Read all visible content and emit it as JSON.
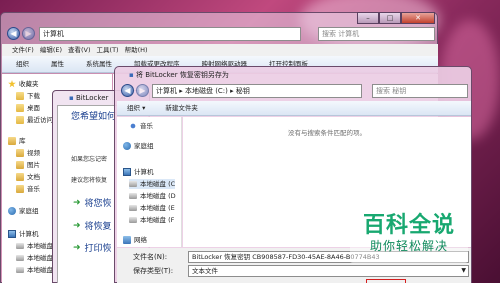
{
  "explorer": {
    "address": "计算机",
    "search_placeholder": "搜索 计算机",
    "menu": [
      "文件(F)",
      "编辑(E)",
      "查看(V)",
      "工具(T)",
      "帮助(H)"
    ],
    "toolbar": [
      "组织",
      "属性",
      "系统属性",
      "卸载或更改程序",
      "映射网络驱动器",
      "打开控制面板"
    ],
    "nav": [
      {
        "label": "收藏夹",
        "icon": "star-icon"
      },
      {
        "label": "下载",
        "icon": "folder-icon"
      },
      {
        "label": "桌面",
        "icon": "folder-icon"
      },
      {
        "label": "最近访问",
        "icon": "folder-icon"
      },
      {
        "label": "库",
        "icon": "library-icon"
      },
      {
        "label": "视频",
        "icon": "library-icon"
      },
      {
        "label": "图片",
        "icon": "library-icon"
      },
      {
        "label": "文档",
        "icon": "library-icon"
      },
      {
        "label": "音乐",
        "icon": "library-icon"
      },
      {
        "label": "家庭组",
        "icon": "homegroup-icon"
      },
      {
        "label": "计算机",
        "icon": "computer-icon"
      },
      {
        "label": "本地磁盘",
        "icon": "disk-icon"
      },
      {
        "label": "本地磁盘",
        "icon": "disk-icon"
      },
      {
        "label": "本地磁盘",
        "icon": "disk-icon"
      }
    ],
    "content_heading": "硬"
  },
  "bitlocker": {
    "title": "BitLocker",
    "question": "您希望如何",
    "para1": "如果您忘记密",
    "para2": "建议您将恢复",
    "option1": "将您恢",
    "option2": "将恢复",
    "option3": "打印恢"
  },
  "saveas": {
    "title": "将 BitLocker 恢复密钥另存为",
    "address": "计算机 ▸ 本地磁盘 (C:) ▸ 秘钥",
    "search_placeholder": "搜索 秘钥",
    "toolbar": [
      "组织 ▾",
      "新建文件夹"
    ],
    "empty_message": "没有与搜索条件匹配的项。",
    "nav": [
      {
        "label": "音乐",
        "icon": "music-icon"
      },
      {
        "label": "家庭组",
        "icon": "homegroup-icon"
      },
      {
        "label": "计算机",
        "icon": "computer-icon"
      },
      {
        "label": "本地磁盘 (C",
        "icon": "disk-icon"
      },
      {
        "label": "本地磁盘 (D",
        "icon": "disk-icon"
      },
      {
        "label": "本地磁盘 (E",
        "icon": "disk-icon"
      },
      {
        "label": "本地磁盘 (F",
        "icon": "disk-icon"
      },
      {
        "label": "网络",
        "icon": "network-icon"
      }
    ],
    "filename_label": "文件名(N):",
    "filename_value": "BitLocker 恢复密钥 CB908587-FD30-45AE-8A46-B0774B43",
    "filetype_label": "保存类型(T):",
    "filetype_value": "文本文件"
  },
  "watermark": {
    "title": "百科全说",
    "subtitle": "助你轻松解决"
  }
}
